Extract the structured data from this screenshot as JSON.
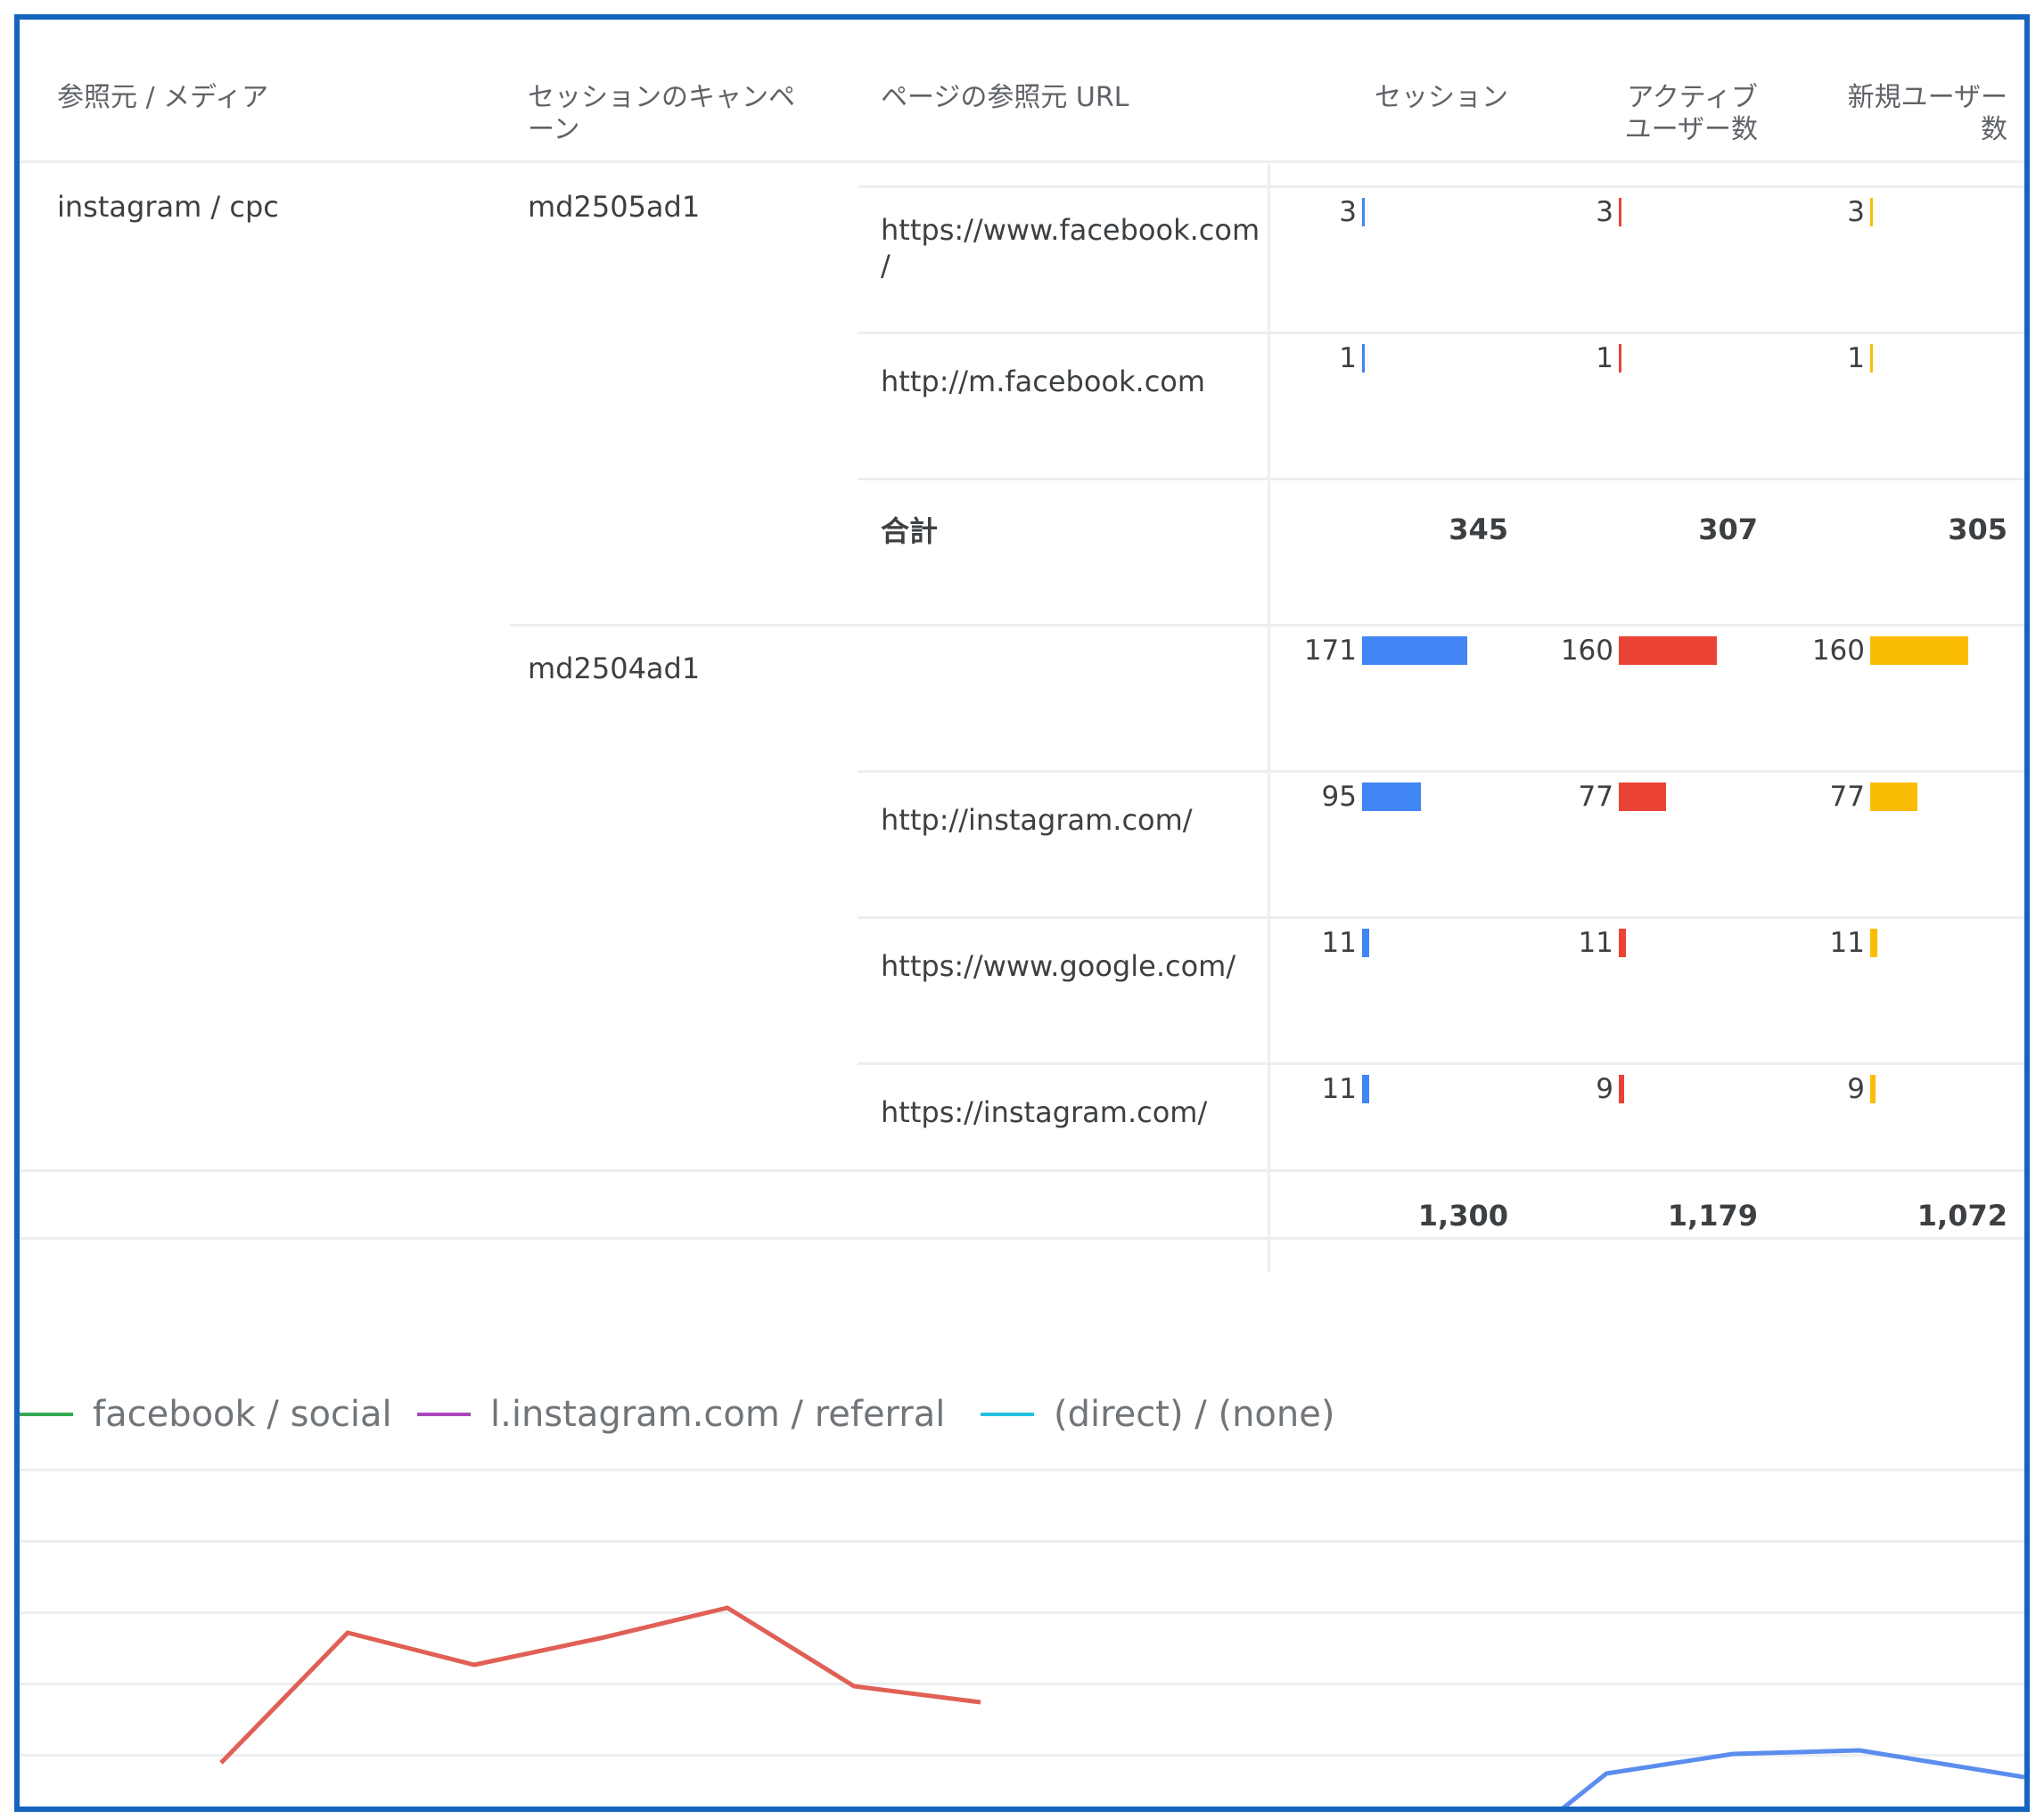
{
  "headers": {
    "source_medium": "参照元 / メディア",
    "campaign_l1": "セッションのキャンペ",
    "campaign_l2": "ーン",
    "referrer": "ページの参照元 URL",
    "sessions": "セッション",
    "active_l1": "アクティブ",
    "active_l2": "ユーザー数",
    "newusers_l1": "新規ユーザー",
    "newusers_l2": "数"
  },
  "source": "instagram / cpc",
  "campaigns": [
    "md2505ad1",
    "md2504ad1"
  ],
  "rows": [
    {
      "url_l1": "https://www.facebook.com",
      "url_l2": "/",
      "sessions": "3",
      "active": "3",
      "new": "3"
    },
    {
      "url_l1": "http://m.facebook.com",
      "url_l2": "",
      "sessions": "1",
      "active": "1",
      "new": "1"
    },
    {
      "url_l1": "",
      "url_l2": "",
      "sessions": "171",
      "active": "160",
      "new": "160"
    },
    {
      "url_l1": "http://instagram.com/",
      "url_l2": "",
      "sessions": "95",
      "active": "77",
      "new": "77"
    },
    {
      "url_l1": "https://www.google.com/",
      "url_l2": "",
      "sessions": "11",
      "active": "11",
      "new": "11"
    },
    {
      "url_l1": "https://instagram.com/",
      "url_l2": "",
      "sessions": "11",
      "active": "9",
      "new": "9"
    }
  ],
  "subtotal": {
    "label": "合計",
    "sessions": "345",
    "active": "307",
    "new": "305"
  },
  "grand_total": {
    "sessions": "1,300",
    "active": "1,179",
    "new": "1,072"
  },
  "bar_scale_max": 171,
  "bar_colors": {
    "sessions": "#4285f4",
    "active": "#ea4335",
    "new": "#fbbc04"
  },
  "legend": [
    {
      "label": "facebook / social",
      "color": "#34a853"
    },
    {
      "label": "l.instagram.com / referral",
      "color": "#ab47bc"
    },
    {
      "label": "(direct) / (none)",
      "color": "#24c1e0"
    }
  ],
  "chart_lines": {
    "red_color": "#e06055",
    "blue_color": "#5b8def"
  }
}
